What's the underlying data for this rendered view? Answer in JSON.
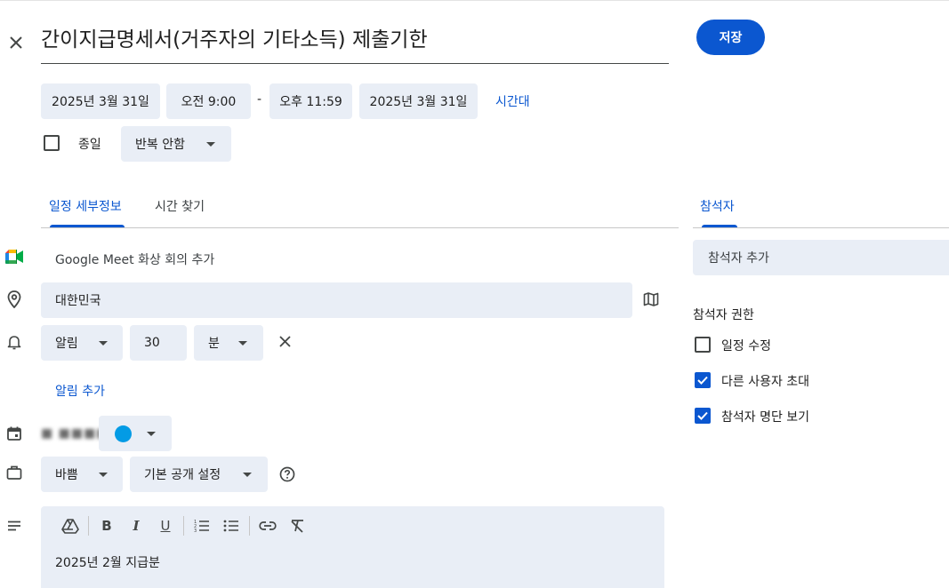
{
  "event": {
    "title": "간이지급명세서(거주자의 기타소득) 제출기한",
    "save_label": "저장"
  },
  "datetime": {
    "start_date": "2025년 3월 31일",
    "start_time": "오전 9:00",
    "separator": "-",
    "end_time": "오후 11:59",
    "end_date": "2025년 3월 31일",
    "timezone_label": "시간대",
    "all_day_label": "종일",
    "all_day_checked": false,
    "repeat_label": "반복 안함"
  },
  "tabs": [
    {
      "label": "일정 세부정보",
      "active": true
    },
    {
      "label": "시간 찾기",
      "active": false
    }
  ],
  "details": {
    "meet_label": "Google Meet 화상 회의 추가",
    "location_value": "대한민국",
    "notification": {
      "type_label": "알림",
      "amount": "30",
      "unit_label": "분"
    },
    "add_notification_label": "알림 추가",
    "calendar_owner_text": "■ ■■■■",
    "calendar_color": "#039be5",
    "availability_label": "바쁨",
    "visibility_label": "기본 공개 설정",
    "description_text": "2025년 2월 지급분",
    "toolbar": {
      "bold": "B",
      "italic": "I",
      "underline": "U"
    }
  },
  "guests": {
    "tab_label": "참석자",
    "add_placeholder": "참석자 추가",
    "permissions_title": "참석자 권한",
    "permissions": [
      {
        "label": "일정 수정",
        "checked": false
      },
      {
        "label": "다른 사용자 초대",
        "checked": true
      },
      {
        "label": "참석자 명단 보기",
        "checked": true
      }
    ]
  },
  "colors": {
    "accent": "#0b57d0",
    "chip_bg": "#e9eef6"
  }
}
